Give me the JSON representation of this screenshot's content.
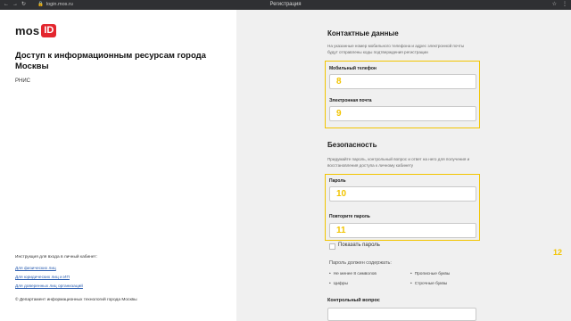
{
  "browser": {
    "url": "login.mos.ru",
    "tab_title": "Регистрация"
  },
  "left": {
    "logo_text": "mos",
    "logo_badge": "ID",
    "heading": "Доступ к информационным ресурсам города Москвы",
    "system": "РНИС",
    "instructions_title": "Инструкция для входа в личный кабинет:",
    "links": [
      "Для физических лиц",
      "Для юридических лиц и ИП",
      "Для доверенных лиц организаций"
    ],
    "copyright": "© Департамент информационных технологий города Москвы"
  },
  "contact": {
    "title": "Контактные данные",
    "description": "На указанные номер мобильного телефона и адрес электронной почты будут отправлены коды подтверждения регистрации",
    "phone_label": "Мобильный телефон",
    "email_label": "Электронная почта"
  },
  "security": {
    "title": "Безопасность",
    "description": "Придумайте пароль, контрольный вопрос и ответ на него для получения и восстановления доступа к личному кабинету",
    "password_label": "Пароль",
    "password_repeat_label": "Повторите пароль",
    "show_password": "Показать пароль",
    "requirements_title": "Пароль должен содержать:",
    "requirements": [
      "Не менее 8 символов",
      "Прописные буквы",
      "Цифры",
      "Строчные буквы"
    ],
    "question_label": "Контрольный вопрос"
  },
  "annotations": [
    "8",
    "9",
    "10",
    "11",
    "12"
  ],
  "colors": {
    "highlight": "#f2c400",
    "brand_red": "#e3262e",
    "link": "#2a5db0"
  }
}
